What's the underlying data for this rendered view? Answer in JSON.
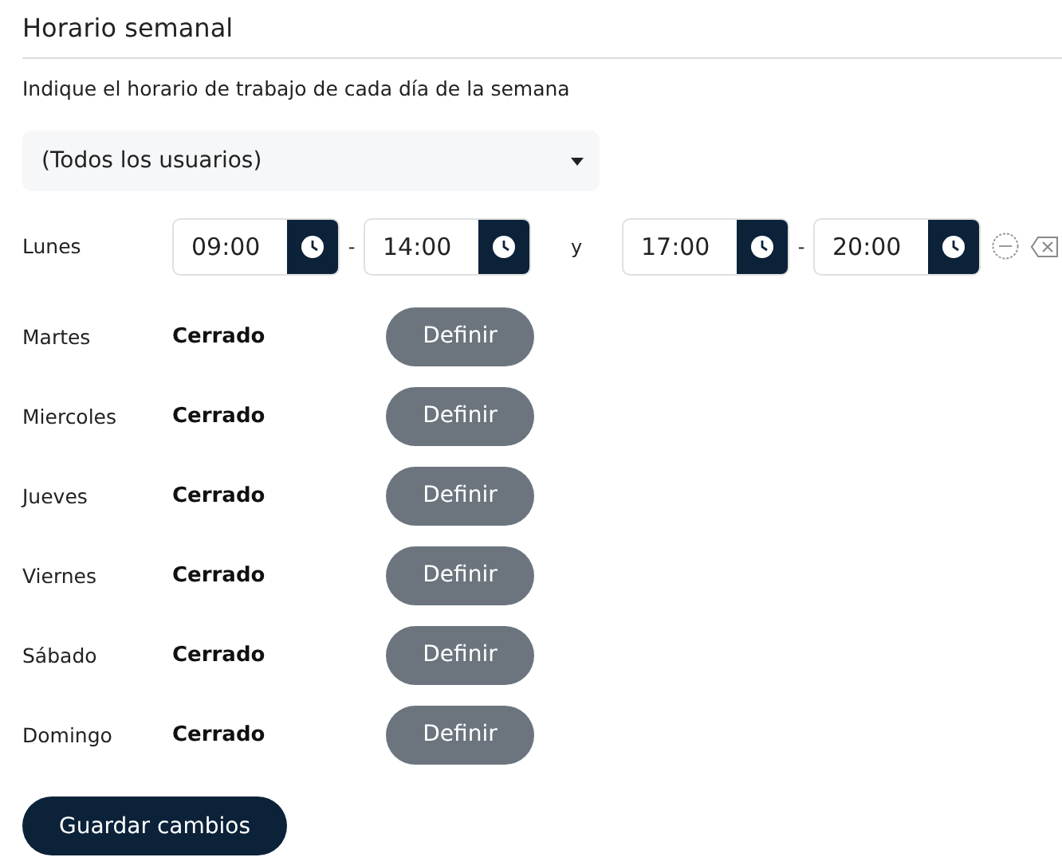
{
  "title": "Horario semanal",
  "description": "Indique el horario de trabajo de cada día de la semana",
  "user_select": {
    "value": "(Todos los usuarios)"
  },
  "days": [
    {
      "name": "Lunes",
      "kind": "open",
      "ranges": [
        {
          "start": "09:00",
          "separator": "-",
          "end": "14:00"
        },
        {
          "joiner": "y",
          "start": "17:00",
          "separator": "-",
          "end": "20:00"
        }
      ]
    },
    {
      "name": "Martes",
      "kind": "closed",
      "status": "Cerrado",
      "button": "Definir"
    },
    {
      "name": "Miercoles",
      "kind": "closed",
      "status": "Cerrado",
      "button": "Definir"
    },
    {
      "name": "Jueves",
      "kind": "closed",
      "status": "Cerrado",
      "button": "Definir"
    },
    {
      "name": "Viernes",
      "kind": "closed",
      "status": "Cerrado",
      "button": "Definir"
    },
    {
      "name": "Sábado",
      "kind": "closed",
      "status": "Cerrado",
      "button": "Definir"
    },
    {
      "name": "Domingo",
      "kind": "closed",
      "status": "Cerrado",
      "button": "Definir"
    }
  ],
  "save_button": "Guardar cambios"
}
